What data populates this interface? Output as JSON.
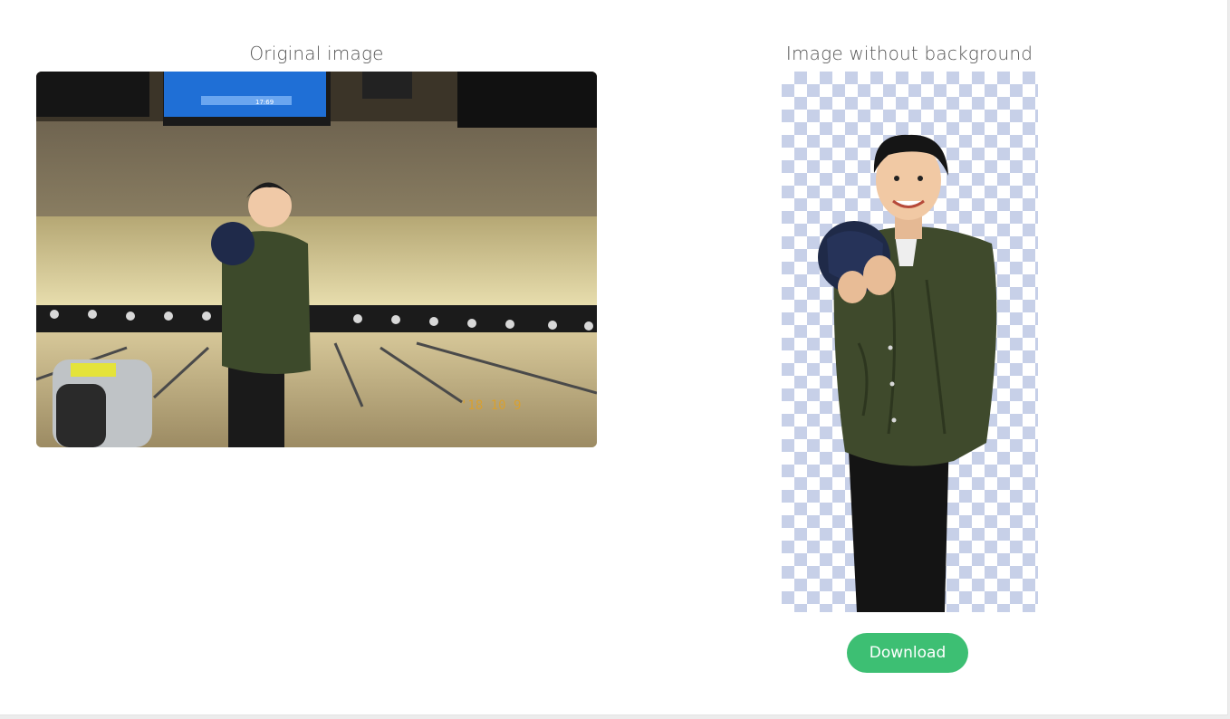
{
  "original": {
    "title": "Original image",
    "photo_date_stamp": "'18 10 9",
    "scoreboard_time": "17:69"
  },
  "result": {
    "title": "Image without background"
  },
  "actions": {
    "download_label": "Download"
  },
  "colors": {
    "button": "#3dbf73",
    "checker": "#c7d0e8",
    "title_text": "#555555"
  }
}
